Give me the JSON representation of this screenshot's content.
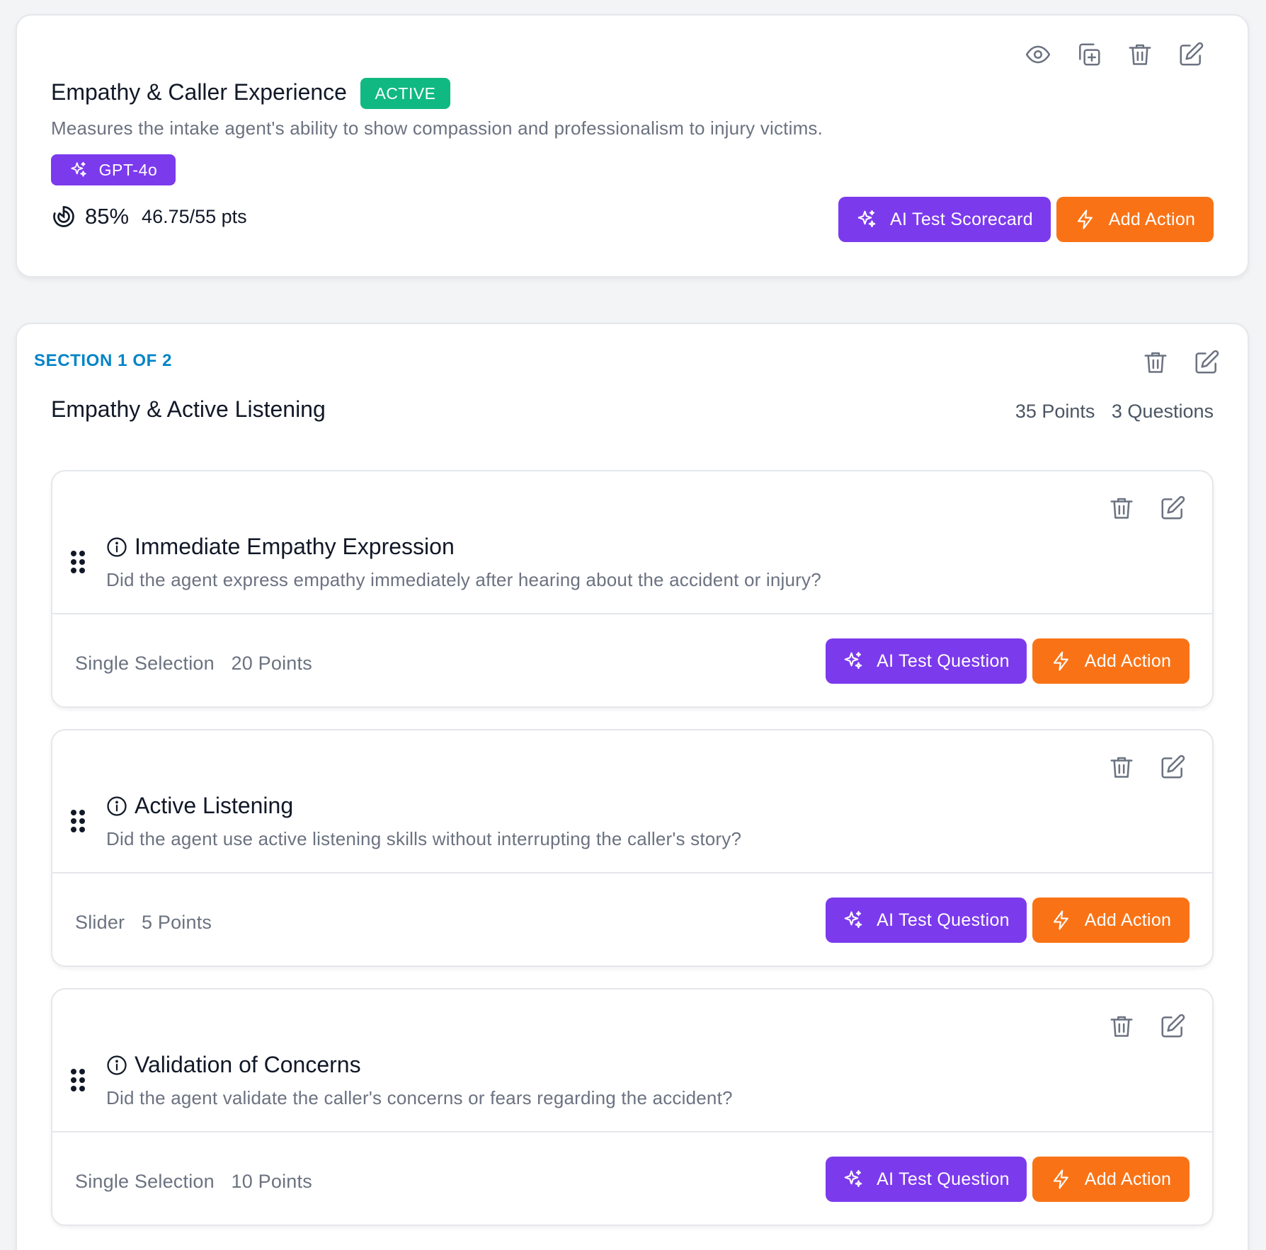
{
  "scorecard": {
    "title": "Empathy & Caller Experience",
    "status": "ACTIVE",
    "description": "Measures the intake agent's ability to show compassion and professionalism to injury victims.",
    "model": "GPT-4o",
    "score_percent": "85%",
    "score_points": "46.75/55 pts",
    "ai_test_label": "AI Test Scorecard",
    "add_action_label": "Add Action"
  },
  "section": {
    "label": "SECTION 1 OF 2",
    "title": "Empathy & Active Listening",
    "points": "35 Points",
    "questions_count": "3 Questions"
  },
  "questions": [
    {
      "title": "Immediate Empathy Expression",
      "description": "Did the agent express empathy immediately after hearing about the accident or injury?",
      "type": "Single Selection",
      "points": "20 Points",
      "ai_test_label": "AI Test Question",
      "add_action_label": "Add Action"
    },
    {
      "title": "Active Listening",
      "description": "Did the agent use active listening skills without interrupting the caller's story?",
      "type": "Slider",
      "points": "5 Points",
      "ai_test_label": "AI Test Question",
      "add_action_label": "Add Action"
    },
    {
      "title": "Validation of Concerns",
      "description": "Did the agent validate the caller's concerns or fears regarding the accident?",
      "type": "Single Selection",
      "points": "10 Points",
      "ai_test_label": "AI Test Question",
      "add_action_label": "Add Action"
    }
  ],
  "colors": {
    "accent_purple": "#7c3aed",
    "accent_orange": "#f97316",
    "status_active": "#10b981",
    "section_label": "#0284c7"
  },
  "icons": [
    "eye-icon",
    "duplicate-icon",
    "trash-icon",
    "edit-icon",
    "sparkles-icon",
    "bolt-icon",
    "score-icon",
    "info-icon",
    "drag-handle-icon"
  ]
}
